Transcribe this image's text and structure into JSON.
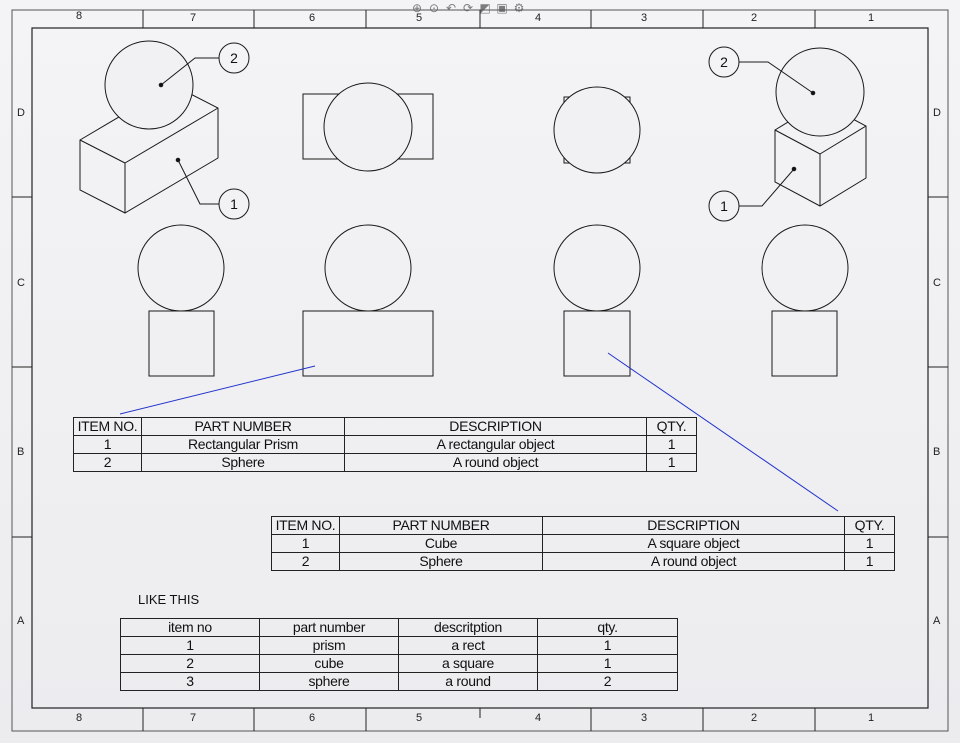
{
  "sheet": {
    "zones_columns": [
      "8",
      "7",
      "6",
      "5",
      "4",
      "3",
      "2",
      "1"
    ],
    "zones_rows": [
      "D",
      "C",
      "B",
      "A"
    ]
  },
  "toolbar": {
    "icons": [
      "zoom-to-fit-icon",
      "zoom-area-icon",
      "previous-view-icon",
      "rotate-view-icon",
      "section-view-icon",
      "display-style-icon",
      "view-orientation-icon"
    ]
  },
  "balloons": {
    "left_top": "2",
    "left_bottom": "1",
    "right_top": "2",
    "right_bottom": "1"
  },
  "bom_table_1": {
    "headers": [
      "ITEM NO.",
      "PART NUMBER",
      "DESCRIPTION",
      "QTY."
    ],
    "rows": [
      [
        "1",
        "Rectangular Prism",
        "A rectangular object",
        "1"
      ],
      [
        "2",
        "Sphere",
        "A round object",
        "1"
      ]
    ]
  },
  "bom_table_2": {
    "headers": [
      "ITEM NO.",
      "PART NUMBER",
      "DESCRIPTION",
      "QTY."
    ],
    "rows": [
      [
        "1",
        "Cube",
        "A square object",
        "1"
      ],
      [
        "2",
        "Sphere",
        "A round object",
        "1"
      ]
    ]
  },
  "note": {
    "label": "LIKE THIS"
  },
  "bom_table_3": {
    "headers": [
      "item no",
      "part number",
      "descritption",
      "qty."
    ],
    "rows": [
      [
        "1",
        "prism",
        "a rect",
        "1"
      ],
      [
        "2",
        "cube",
        "a square",
        "1"
      ],
      [
        "3",
        "sphere",
        "a round",
        "2"
      ]
    ]
  },
  "colors": {
    "line": "#1a1a1a",
    "annotation": "#2233cc",
    "paper": "#f0f0f2"
  }
}
